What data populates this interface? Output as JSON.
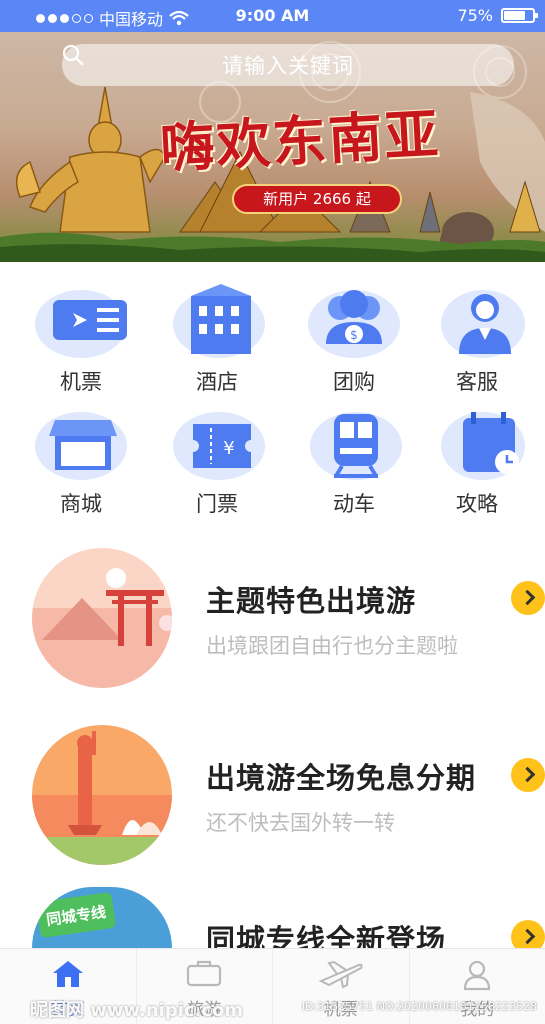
{
  "status_bar": {
    "carrier": "中国移动",
    "time": "9:00 AM",
    "battery_text": "75%",
    "battery_level": 0.75
  },
  "search": {
    "placeholder": "请输入关键词"
  },
  "banner": {
    "title": "嗨欢东南亚",
    "badge": "新用户 2666 起"
  },
  "categories": [
    {
      "label": "机票",
      "icon": "plane-ticket-icon"
    },
    {
      "label": "酒店",
      "icon": "hotel-building-icon"
    },
    {
      "label": "团购",
      "icon": "group-buy-icon"
    },
    {
      "label": "客服",
      "icon": "customer-service-icon"
    },
    {
      "label": "商城",
      "icon": "shop-store-icon"
    },
    {
      "label": "门票",
      "icon": "admission-ticket-icon"
    },
    {
      "label": "动车",
      "icon": "train-icon"
    },
    {
      "label": "攻略",
      "icon": "calendar-guide-icon"
    }
  ],
  "features": [
    {
      "title": "主题特色出境游",
      "subtitle": "出境跟团自由行也分主题啦"
    },
    {
      "title": "出境游全场免息分期",
      "subtitle": "还不快去国外转一转"
    },
    {
      "title": "同城专线全新登场",
      "subtitle": "",
      "badge_text": "同城专线"
    }
  ],
  "tabbar": [
    {
      "label": "首页",
      "icon": "home-icon",
      "active": true
    },
    {
      "label": "旅游",
      "icon": "suitcase-icon",
      "active": false
    },
    {
      "label": "机票",
      "icon": "airplane-icon",
      "active": false
    },
    {
      "label": "我的",
      "icon": "user-icon",
      "active": false
    }
  ],
  "watermark": {
    "site": "昵图网 www.nipic.com",
    "id": "ID:31525751 NO:20200606181258223528"
  },
  "colors": {
    "primary": "#5b86f5",
    "accent": "#ffc21a",
    "banner_red": "#c8161d"
  }
}
